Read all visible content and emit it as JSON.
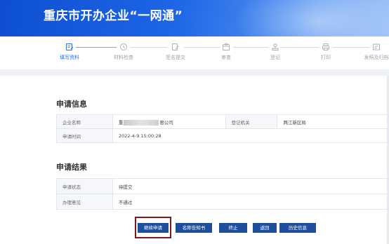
{
  "header": {
    "title": "重庆市开办企业“一网通”",
    "accent": "#1e66e6"
  },
  "steps": [
    {
      "label": "填写资料",
      "icon": "edit-icon",
      "active": true
    },
    {
      "label": "材料检查",
      "icon": "clock-icon",
      "active": false
    },
    {
      "label": "签名提交",
      "icon": "sign-icon",
      "active": false
    },
    {
      "label": "审查",
      "icon": "review-icon",
      "active": false
    },
    {
      "label": "登记",
      "icon": "stamp-icon",
      "active": false
    },
    {
      "label": "打印",
      "icon": "printer-icon",
      "active": false
    },
    {
      "label": "发照及归档",
      "icon": "archive-icon",
      "active": false
    }
  ],
  "application_info": {
    "title": "申请信息",
    "rows": [
      {
        "k1": "企业名称",
        "v1_prefix": "重",
        "v1_suffix": "限公司",
        "k2": "登记机关",
        "v2": "两江新区局"
      },
      {
        "k1": "申请时间",
        "v1": "2022-4-9 15:00:28"
      }
    ]
  },
  "application_result": {
    "title": "申请结果",
    "rows": [
      {
        "k": "申请状态",
        "v": "待提交"
      },
      {
        "k": "办理意见",
        "v": "不通过"
      }
    ]
  },
  "actions": {
    "continue": "继续申请",
    "name_notice": "名称告知书",
    "terminate": "终止",
    "back": "返回",
    "history": "历史信息"
  }
}
